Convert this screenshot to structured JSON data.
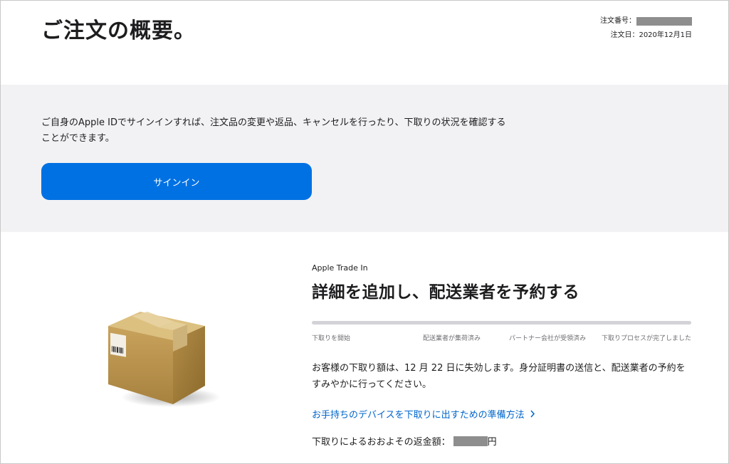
{
  "header": {
    "title": "ご注文の概要。",
    "order_number_label": "注文番号：",
    "order_date": "注文日：2020年12月1日"
  },
  "signin": {
    "message": "ご自身のApple IDでサインインすれば、注文品の変更や返品、キャンセルを行ったり、下取りの状況を確認することができます。",
    "button_label": "サインイン"
  },
  "trade_in": {
    "eyebrow": "Apple Trade In",
    "heading": "詳細を追加し、配送業者を予約する",
    "progress_fraction": 0,
    "steps": [
      "下取りを開始",
      "配送業者が集荷済み",
      "パートナー会社が受領済み",
      "下取りプロセスが完了しました"
    ],
    "notice": "お客様の下取り額は、12 月 22 日に失効します。身分証明書の送信と、配送業者の予約をすみやかに行ってください。",
    "prep_link": "お手持ちのデバイスを下取りに出すための準備方法",
    "prep_link_icon": "chevron-right-icon",
    "refund_label": "下取りによるおおよその返金額：",
    "refund_currency": "円"
  },
  "colors": {
    "accent": "#0071e3",
    "link": "#0066cc",
    "band": "#f2f2f4",
    "redaction": "#8e8e8e"
  }
}
